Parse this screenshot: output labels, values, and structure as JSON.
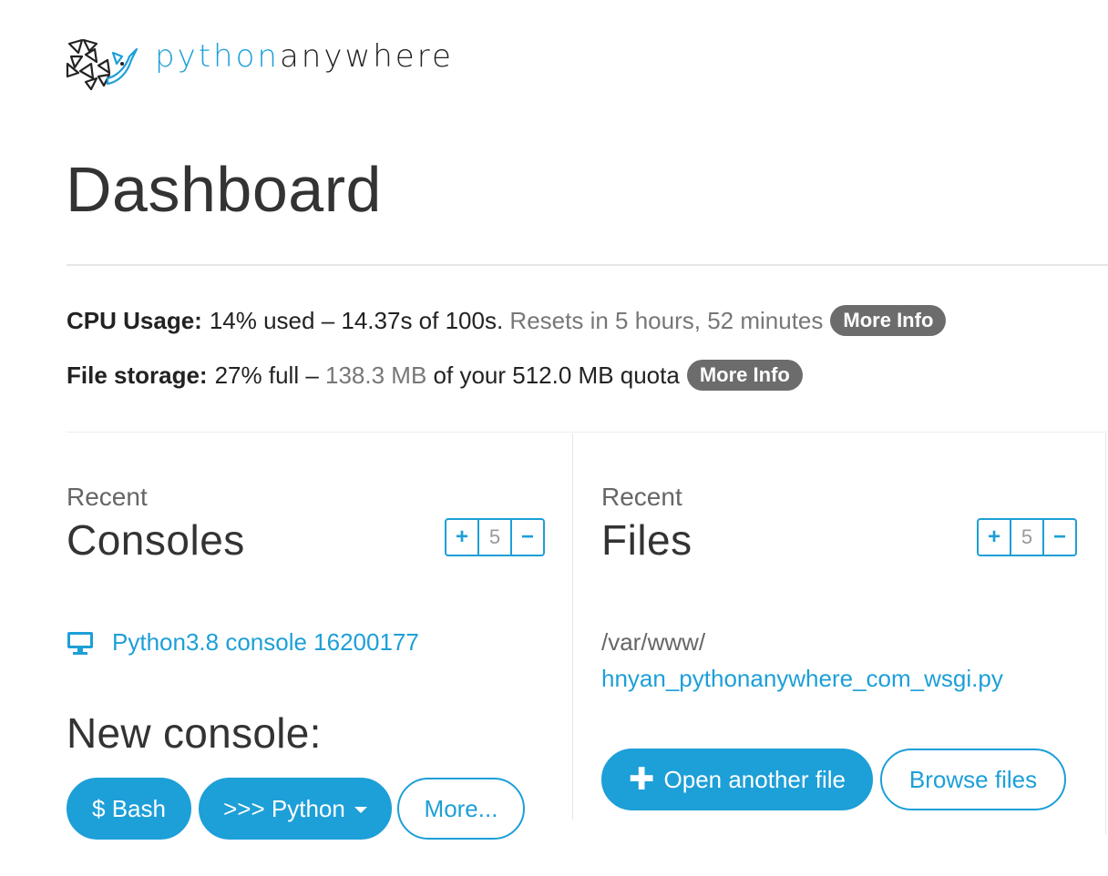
{
  "header": {
    "logo_part1": "python",
    "logo_part2": "anywhere"
  },
  "page_title": "Dashboard",
  "usage": {
    "cpu_label": "CPU Usage:",
    "cpu_text": "14% used – 14.37s of 100s.",
    "cpu_reset": "Resets in 5 hours, 52 minutes",
    "cpu_more": "More Info",
    "storage_label": "File storage:",
    "storage_text_a": "27% full –",
    "storage_used": "138.3 MB",
    "storage_text_b": "of your 512.0 MB quota",
    "storage_more": "More Info"
  },
  "consoles": {
    "recent_label": "Recent",
    "title": "Consoles",
    "stepper": {
      "plus": "+",
      "value": "5",
      "minus": "−"
    },
    "items": [
      {
        "label": "Python3.8 console 16200177",
        "icon": "monitor-icon"
      }
    ],
    "new_console_label": "New console:",
    "buttons": {
      "bash": "$ Bash",
      "python": ">>> Python",
      "more": "More..."
    }
  },
  "files": {
    "recent_label": "Recent",
    "title": "Files",
    "stepper": {
      "plus": "+",
      "value": "5",
      "minus": "−"
    },
    "items": [
      {
        "dir": "/var/www/",
        "name": "hnyan_pythonanywhere_com_wsgi.py"
      }
    ],
    "buttons": {
      "open_another": "Open another file",
      "browse": "Browse files"
    }
  },
  "colors": {
    "accent": "#1d9fd8",
    "pill": "#6c6c6c",
    "text": "#222222",
    "muted": "#777777"
  }
}
